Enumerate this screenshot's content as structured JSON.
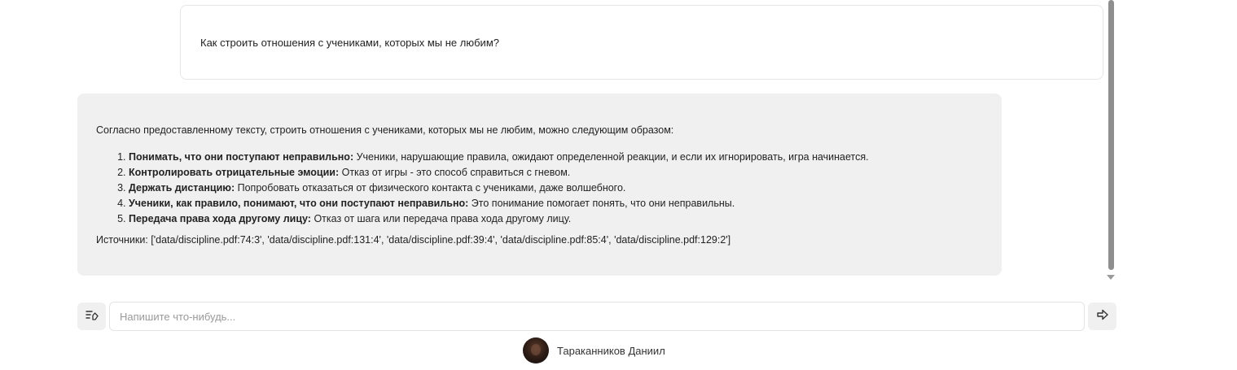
{
  "chat": {
    "user_message": "Как строить отношения с учениками, которых мы не любим?",
    "bot_message": {
      "intro": "Согласно предоставленному тексту, строить отношения с учениками, которых мы не любим, можно следующим образом:",
      "items": [
        {
          "bold": "Понимать, что они поступают неправильно:",
          "text": " Ученики, нарушающие правила, ожидают определенной реакции, и если их игнорировать, игра начинается."
        },
        {
          "bold": "Контролировать отрицательные эмоции:",
          "text": " Отказ от игры - это способ справиться с гневом."
        },
        {
          "bold": "Держать дистанцию:",
          "text": " Попробовать отказаться от физического контакта с учениками, даже волшебного."
        },
        {
          "bold": "Ученики, как правило, понимают, что они поступают неправильно:",
          "text": " Это понимание помогает понять, что они неправильны."
        },
        {
          "bold": "Передача права хода другому лицу:",
          "text": " Отказ от шага или передача права хода другому лицу."
        }
      ],
      "sources": "Источники: ['data/discipline.pdf:74:3', 'data/discipline.pdf:131:4', 'data/discipline.pdf:39:4', 'data/discipline.pdf:85:4', 'data/discipline.pdf:129:2']"
    }
  },
  "input": {
    "value": "",
    "placeholder": "Напишите что-нибудь..."
  },
  "icons": {
    "clear": "clear-chat-icon",
    "send": "send-arrow-icon"
  },
  "user": {
    "name": "Тараканников Даниил"
  }
}
